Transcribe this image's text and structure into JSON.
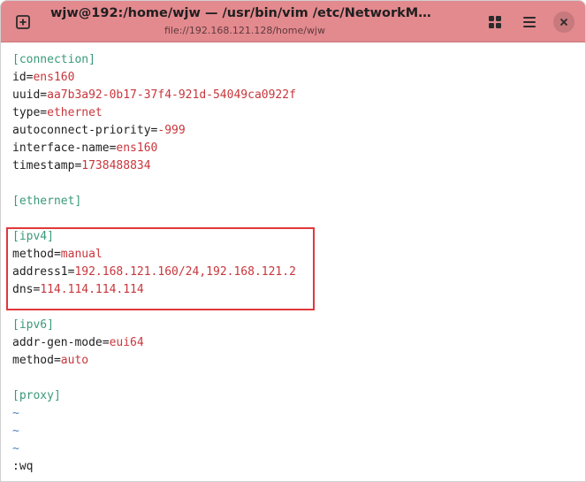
{
  "window": {
    "title": "wjw@192:/home/wjw — /usr/bin/vim /etc/NetworkManager/sy…",
    "subtitle": "file://192.168.121.128/home/wjw"
  },
  "icons": {
    "new_tab": "plus-square-icon",
    "grid": "grid-icon",
    "menu": "hamburger-menu-icon",
    "close": "close-icon"
  },
  "colors": {
    "titlebar": "#e38a8f",
    "section": "#3a9a78",
    "value": "#c8363c",
    "tilde": "#4a7fc0",
    "highlight": "#e0383c"
  },
  "editor": {
    "connection_header": "[connection]",
    "id_key": "id=",
    "id_val": "ens160",
    "uuid_key": "uuid=",
    "uuid_val": "aa7b3a92-0b17-37f4-921d-54049ca0922f",
    "type_key": "type=",
    "type_val": "ethernet",
    "autoconnect_key": "autoconnect-priority=",
    "autoconnect_val": "-999",
    "ifname_key": "interface-name=",
    "ifname_val": "ens160",
    "timestamp_key": "timestamp=",
    "timestamp_val": "1738488834",
    "ethernet_header": "[ethernet]",
    "ipv4_header": "[ipv4]",
    "ipv4_method_key": "method=",
    "ipv4_method_val": "manual",
    "address_key": "address1=",
    "address_val": "192.168.121.160/24,192.168.121.2",
    "dns_key": "dns=",
    "dns_val": "114.114.114.114",
    "ipv6_header": "[ipv6]",
    "addrgen_key": "addr-gen-mode=",
    "addrgen_val": "eui64",
    "ipv6_method_key": "method=",
    "ipv6_method_val": "auto",
    "proxy_header": "[proxy]",
    "tilde": "~",
    "command": ":wq"
  }
}
